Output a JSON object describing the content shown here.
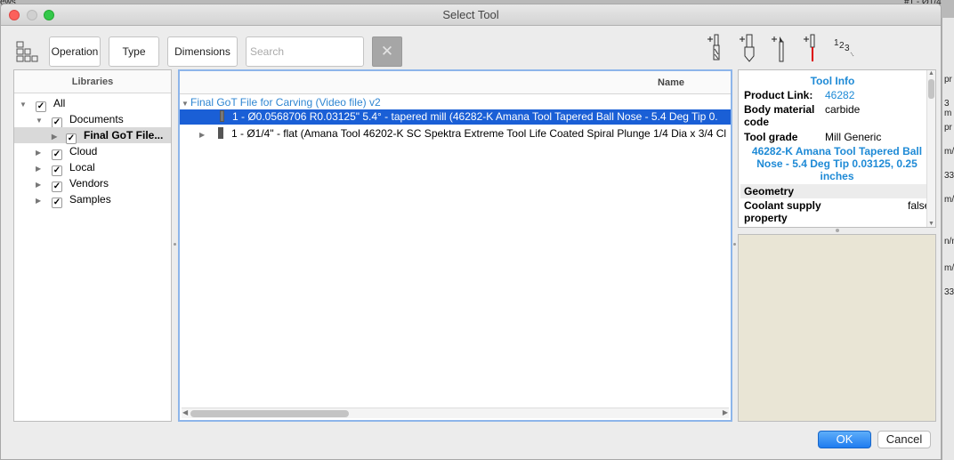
{
  "window": {
    "title": "Select Tool"
  },
  "background": {
    "left_text": "ews",
    "top_right_text": "#1 - Ø1/4",
    "right_snippets": [
      "pr",
      "3 m",
      "pr",
      "m/",
      "33",
      "m/",
      "n/m",
      "m/",
      "33"
    ]
  },
  "toolbar": {
    "operation_label": "Operation",
    "type_label": "Type",
    "dimensions_label": "Dimensions",
    "search_placeholder": "Search",
    "clear_label": "✕",
    "icons": [
      "list-view-icon",
      "mill-tool-icon",
      "drill-tool-icon",
      "turning-tool-icon",
      "probe-tool-icon",
      "numbering-icon"
    ]
  },
  "libraries": {
    "header": "Libraries",
    "items": [
      {
        "label": "All",
        "checked": true,
        "expanded": true
      },
      {
        "label": "Documents",
        "checked": true,
        "expanded": true
      },
      {
        "label": "Final GoT File...",
        "checked": true,
        "expanded": false,
        "selected": true
      },
      {
        "label": "Cloud",
        "checked": true,
        "expanded": false
      },
      {
        "label": "Local",
        "checked": true,
        "expanded": false
      },
      {
        "label": "Vendors",
        "checked": true,
        "expanded": false
      },
      {
        "label": "Samples",
        "checked": true,
        "expanded": false
      }
    ]
  },
  "tools": {
    "header": "Name",
    "group": "Final GoT File for Carving (Video file) v2",
    "rows": [
      {
        "label": "1 - Ø0.0568706 R0.03125\" 5.4° - tapered mill (46282-K Amana Tool Tapered Ball Nose - 5.4 Deg Tip 0.",
        "selected": true
      },
      {
        "label": "1 - Ø1/4\" - flat (Amana Tool 46202-K SC Spektra Extreme Tool Life Coated Spiral Plunge 1/4 Dia x 3/4 Cl",
        "selected": false
      }
    ]
  },
  "tool_info": {
    "title": "Tool Info",
    "product_link_label": "Product Link:",
    "product_link_value": "46282",
    "body_material_label": "Body material code",
    "body_material_value": "carbide",
    "tool_grade_label": "Tool grade",
    "tool_grade_value": "Mill Generic",
    "description": "46282-K Amana Tool Tapered Ball Nose - 5.4 Deg Tip 0.03125, 0.25 inches",
    "geometry_label": "Geometry",
    "coolant_label": "Coolant supply property",
    "coolant_value": "false"
  },
  "buttons": {
    "ok": "OK",
    "cancel": "Cancel"
  },
  "colors": {
    "selection": "#1a5fd6",
    "link": "#1e8ad6",
    "preview_bg": "#e9e5d5",
    "ok_button": "#2f87f3"
  }
}
